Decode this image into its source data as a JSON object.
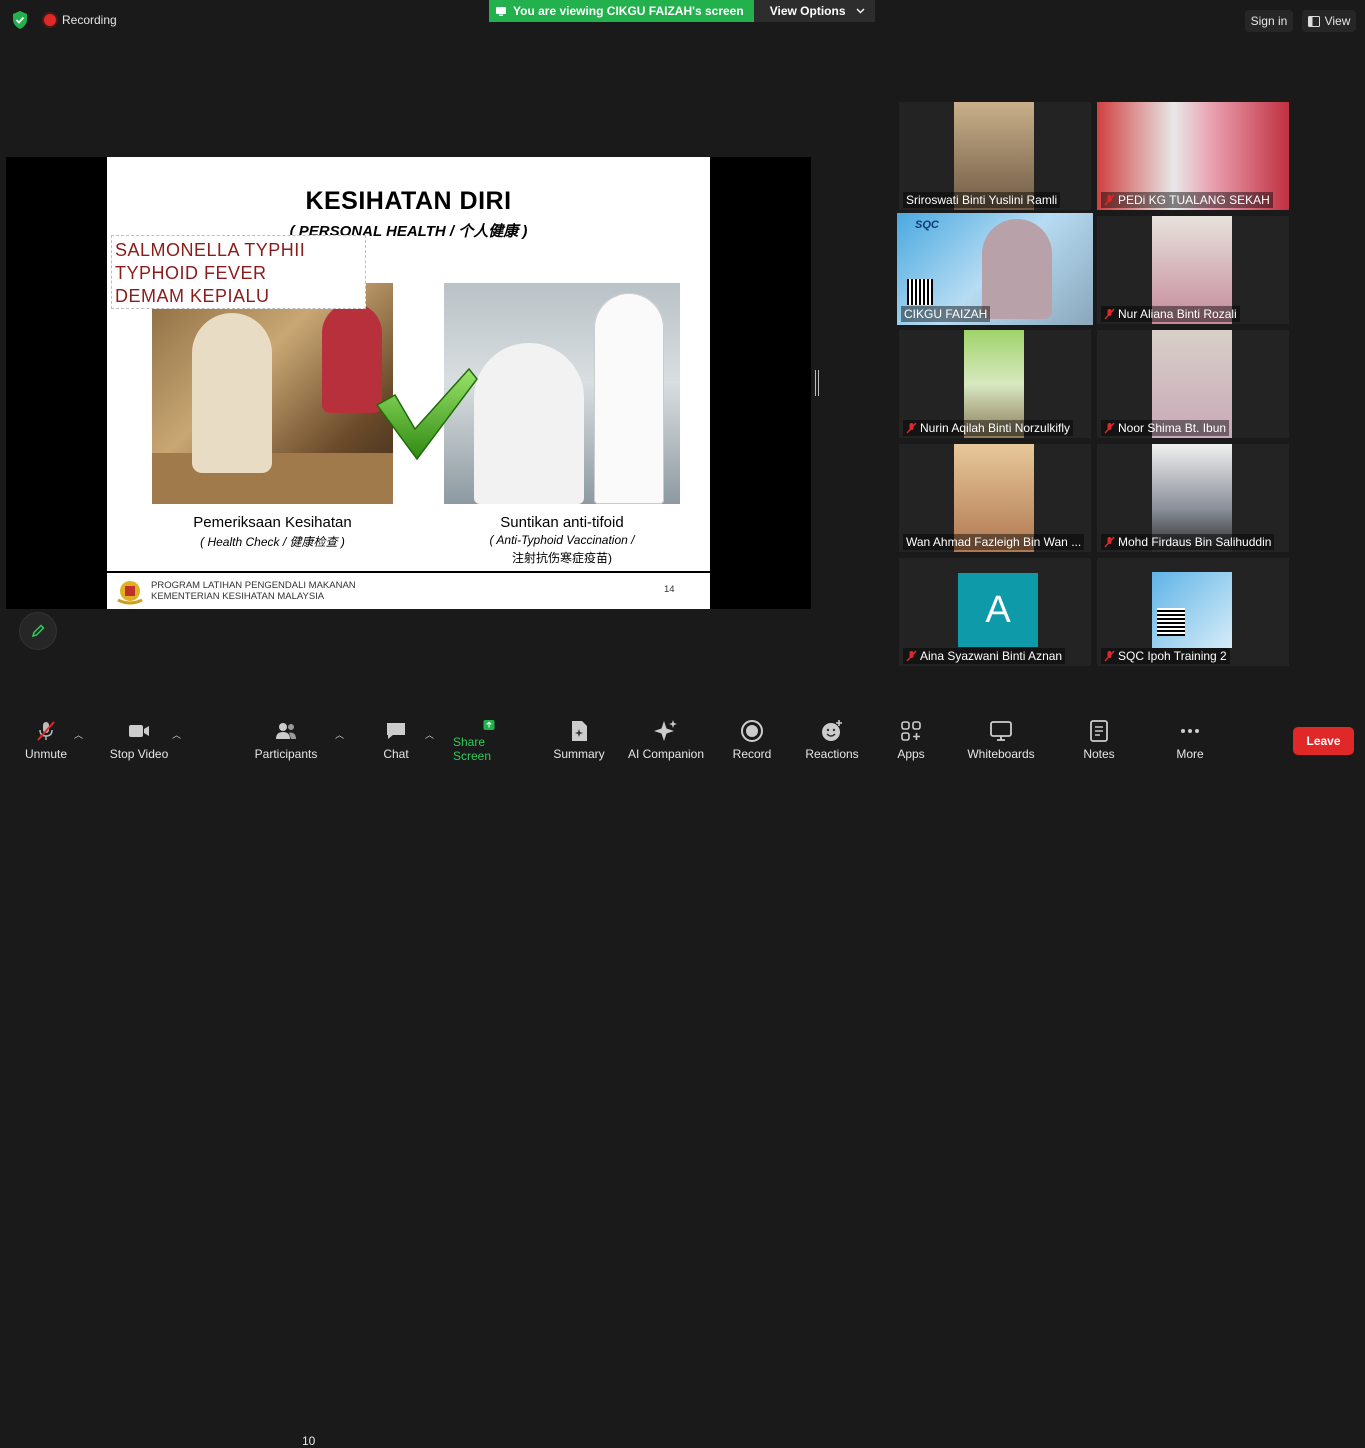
{
  "topbar": {
    "recording_label": "Recording",
    "viewing_label": "You are viewing CIKGU FAIZAH's screen",
    "view_options_label": "View Options",
    "sign_in_label": "Sign in",
    "view_label": "View"
  },
  "slide": {
    "title": "KESIHATAN DIRI",
    "subtitle": "( PERSONAL HEALTH / 个人健康 )",
    "annotation_lines": [
      "SALMONELLA TYPHII",
      "TYPHOID FEVER",
      "DEMAM KEPIALU"
    ],
    "caption_left": "Pemeriksaan Kesihatan",
    "caption_left_sub": "( Health Check / 健康检查 )",
    "caption_right": "Suntikan anti-tifoid",
    "caption_right_sub": "( Anti-Typhoid Vaccination /",
    "caption_right_sub2": "注射抗伤寒症疫苗)",
    "footer_line1": "PROGRAM LATIHAN PENGENDALI MAKANAN",
    "footer_line2": "KEMENTERIAN KESIHATAN MALAYSIA",
    "page_number": "14"
  },
  "participants": [
    {
      "name": "Sriroswati Binti Yuslini Ramli",
      "muted": false
    },
    {
      "name": "PEDi KG TUALANG SEKAH",
      "muted": true
    },
    {
      "name": "CIKGU FAIZAH",
      "muted": false,
      "active": true
    },
    {
      "name": "Nur Aliana Binti Rozali",
      "muted": true
    },
    {
      "name": "Nurin Aqilah Binti Norzulkifly",
      "muted": true
    },
    {
      "name": "Noor Shima Bt. Ibun",
      "muted": true
    },
    {
      "name": "Wan Ahmad Fazleigh Bin Wan ...",
      "muted": false
    },
    {
      "name": "Mohd Firdaus Bin Salihuddin",
      "muted": true
    },
    {
      "name": "Aina Syazwani Binti Aznan",
      "muted": true,
      "avatar_letter": "A"
    },
    {
      "name": "SQC Ipoh Training 2",
      "muted": true
    }
  ],
  "presenter_overlay": {
    "logo": "SQC"
  },
  "toolbar": {
    "unmute": "Unmute",
    "stop_video": "Stop Video",
    "participants": "Participants",
    "participants_count": "10",
    "chat": "Chat",
    "share_screen": "Share Screen",
    "summary": "Summary",
    "ai_companion": "AI Companion",
    "record": "Record",
    "reactions": "Reactions",
    "apps": "Apps",
    "whiteboards": "Whiteboards",
    "notes": "Notes",
    "more": "More",
    "leave": "Leave"
  },
  "colors": {
    "background": "#1a1a1a",
    "viewing_banner": "#23b14d",
    "leave_button": "#e02828",
    "active_speaker": "#f3e84b",
    "annotation_text": "#8b1c1c"
  }
}
